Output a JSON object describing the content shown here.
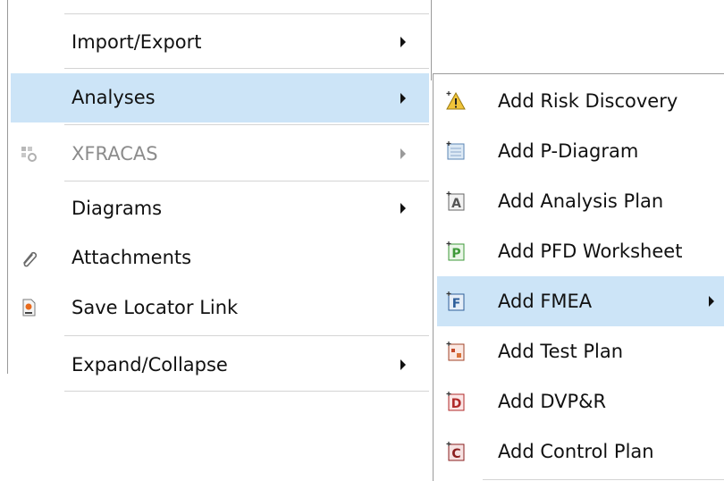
{
  "main_menu": {
    "items": [
      {
        "label": "Import/Export",
        "has_submenu": true,
        "enabled": true
      },
      {
        "label": "Analyses",
        "has_submenu": true,
        "enabled": true,
        "highlighted": true
      },
      {
        "label": "XFRACAS",
        "has_submenu": true,
        "enabled": false,
        "icon": "xfracas-icon"
      },
      {
        "label": "Diagrams",
        "has_submenu": true,
        "enabled": true
      },
      {
        "label": "Attachments",
        "has_submenu": false,
        "enabled": true,
        "icon": "paperclip-icon"
      },
      {
        "label": "Save Locator Link",
        "has_submenu": false,
        "enabled": true,
        "icon": "locator-link-icon"
      },
      {
        "label": "Expand/Collapse",
        "has_submenu": true,
        "enabled": true
      }
    ]
  },
  "analyses_submenu": {
    "items": [
      {
        "label": "Add Risk Discovery",
        "icon": "risk-discovery-icon"
      },
      {
        "label": "Add P-Diagram",
        "icon": "p-diagram-icon"
      },
      {
        "label": "Add Analysis Plan",
        "icon": "analysis-plan-icon",
        "icon_letter": "A"
      },
      {
        "label": "Add PFD Worksheet",
        "icon": "pfd-worksheet-icon",
        "icon_letter": "P"
      },
      {
        "label": "Add FMEA",
        "icon": "fmea-icon",
        "icon_letter": "F",
        "highlighted": true,
        "has_submenu": true
      },
      {
        "label": "Add Test Plan",
        "icon": "test-plan-icon"
      },
      {
        "label": "Add DVP&R",
        "icon": "dvpr-icon",
        "icon_letter": "D"
      },
      {
        "label": "Add Control Plan",
        "icon": "control-plan-icon",
        "icon_letter": "C"
      }
    ]
  },
  "colors": {
    "highlight": "#cce4f7",
    "border": "#9a9a9a",
    "separator": "#d4d4d4",
    "disabled_text": "#8c8c8c"
  }
}
